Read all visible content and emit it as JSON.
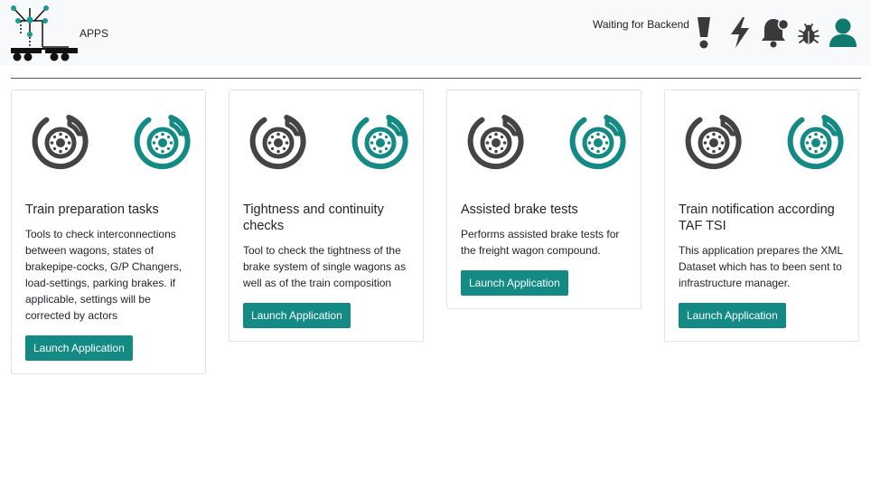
{
  "header": {
    "app_label": "APPS",
    "status_text": "Waiting for Backend",
    "icons": [
      "exclamation-icon",
      "lightning-icon",
      "bell-icon",
      "bug-icon",
      "user-icon"
    ]
  },
  "colors": {
    "accent": "#148a84",
    "icon_grey": "#444444",
    "header_bg": "#f8f9fa"
  },
  "cards": [
    {
      "title": "Train preparation tasks",
      "description": "Tools to check interconnections between wagons, states of brakepipe-cocks, G/P Changers, load-settings, parking brakes. if applicable, settings will be corrected by actors",
      "button_label": "Launch Application"
    },
    {
      "title": "Tightness and continuity checks",
      "description": "Tool to check the tightness of the brake system of single wagons as well as of the train composition",
      "button_label": "Launch Application"
    },
    {
      "title": "Assisted brake tests",
      "description": "Performs assisted brake tests for the freight wagon compound.",
      "button_label": "Launch Application"
    },
    {
      "title": "Train notification according TAF TSI",
      "description": "This application prepares the XML Dataset which has to been sent to infrastructure manager.",
      "button_label": "Launch Application"
    }
  ]
}
